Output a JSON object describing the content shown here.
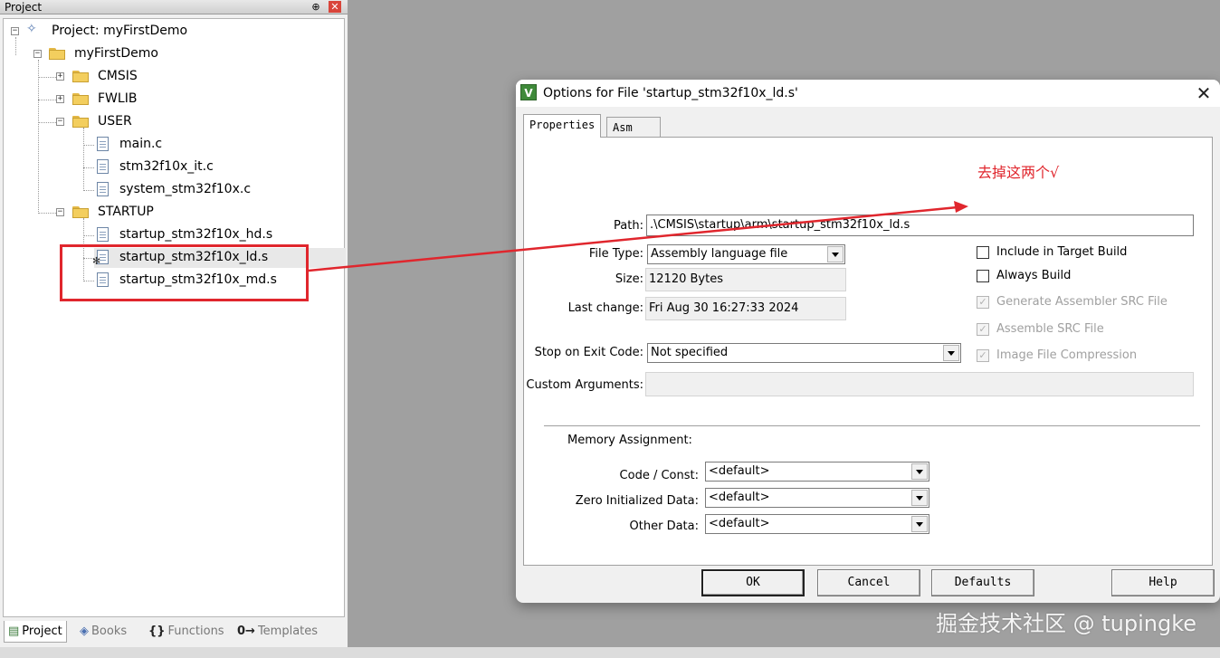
{
  "project_panel": {
    "title": "Project",
    "pin_glyph": "⊕",
    "close_glyph": "✕",
    "tree": {
      "root": "Project: myFirstDemo",
      "target": "myFirstDemo",
      "groups": [
        "CMSIS",
        "FWLIB",
        "USER",
        "STARTUP"
      ],
      "user_files": [
        "main.c",
        "stm32f10x_it.c",
        "system_stm32f10x.c"
      ],
      "startup_files": [
        "startup_stm32f10x_hd.s",
        "startup_stm32f10x_ld.s",
        "startup_stm32f10x_md.s"
      ]
    },
    "bottom_tabs": [
      "Project",
      "Books",
      "Functions",
      "Templates"
    ],
    "bottom_tab_icons": [
      "▤",
      "◈",
      "{}",
      "0→"
    ]
  },
  "dialog": {
    "title": "Options for File 'startup_stm32f10x_ld.s'",
    "tabs": [
      "Properties",
      "Asm"
    ],
    "path_label": "Path:",
    "path_value": ".\\CMSIS\\startup\\arm\\startup_stm32f10x_ld.s",
    "file_type_label": "File Type:",
    "file_type_value": "Assembly language file",
    "size_label": "Size:",
    "size_value": "12120 Bytes",
    "last_change_label": "Last change:",
    "last_change_value": "Fri Aug 30 16:27:33 2024",
    "stop_label": "Stop on Exit Code:",
    "stop_value": "Not specified",
    "custom_args_label": "Custom Arguments:",
    "checkboxes": {
      "include": "Include in Target Build",
      "always": "Always Build",
      "gen_asm": "Generate Assembler SRC File",
      "assemble": "Assemble SRC File",
      "image": "Image File Compression",
      "check_glyph": "✓"
    },
    "memory": {
      "heading": "Memory Assignment:",
      "code_label": "Code / Const:",
      "zero_label": "Zero Initialized Data:",
      "other_label": "Other Data:",
      "code_value": "<default>",
      "zero_value": "<default>",
      "other_value": "<default>"
    },
    "buttons": {
      "ok": "OK",
      "cancel": "Cancel",
      "defaults": "Defaults",
      "help": "Help"
    }
  },
  "annotation": {
    "text": "去掉这两个√",
    "color": "#e0262d"
  },
  "watermark": "掘金技术社区 @ tupingke"
}
